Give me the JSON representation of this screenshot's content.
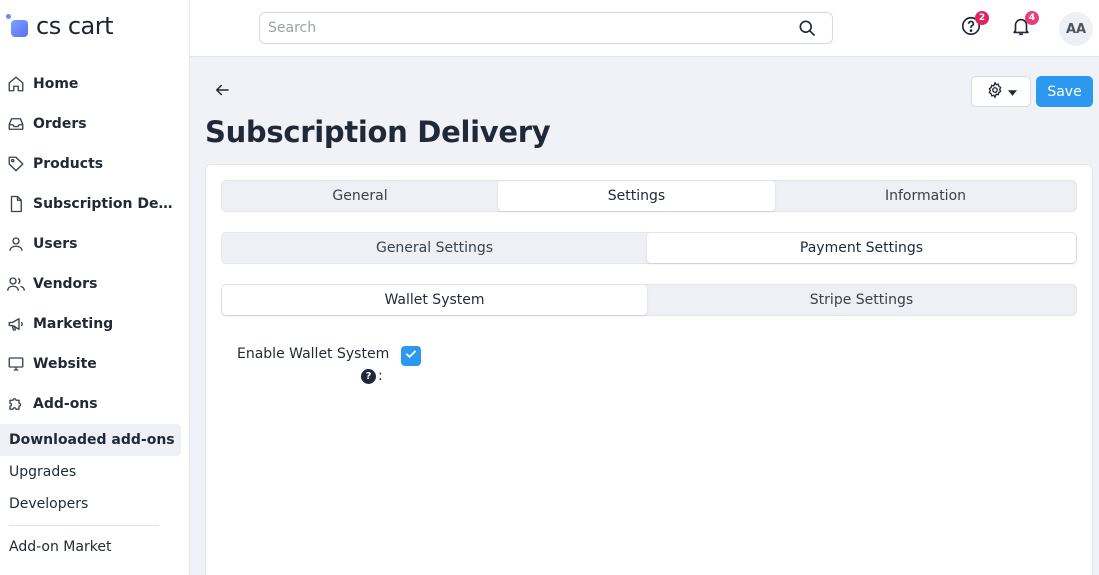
{
  "app": {
    "logo_text": "cs cart"
  },
  "sidebar": {
    "items": [
      {
        "label": "Home",
        "icon": "home-icon"
      },
      {
        "label": "Orders",
        "icon": "inbox-icon"
      },
      {
        "label": "Products",
        "icon": "tag-icon"
      },
      {
        "label": "Subscription Delivery",
        "icon": "file-icon"
      },
      {
        "label": "Users",
        "icon": "user-icon"
      },
      {
        "label": "Vendors",
        "icon": "users-icon"
      },
      {
        "label": "Marketing",
        "icon": "megaphone-icon"
      },
      {
        "label": "Website",
        "icon": "monitor-icon"
      },
      {
        "label": "Add-ons",
        "icon": "puzzle-icon"
      }
    ],
    "subitems": [
      {
        "label": "Downloaded add-ons",
        "active": true
      },
      {
        "label": "Upgrades",
        "active": false
      },
      {
        "label": "Developers",
        "active": false
      },
      {
        "label": "Add-on Market",
        "active": false
      }
    ]
  },
  "topbar": {
    "search_placeholder": "Search",
    "help_badge": "2",
    "notifications_badge": "4",
    "avatar_initials": "AA",
    "badge_help_color": "#e0245e",
    "badge_notif_color": "#e6407a"
  },
  "page": {
    "title": "Subscription Delivery",
    "save_label": "Save",
    "accent_color": "#2c98f0"
  },
  "tabs": {
    "main": [
      {
        "label": "General",
        "active": false
      },
      {
        "label": "Settings",
        "active": true
      },
      {
        "label": "Information",
        "active": false
      }
    ],
    "settings": [
      {
        "label": "General Settings",
        "active": false
      },
      {
        "label": "Payment Settings",
        "active": true
      }
    ],
    "payment": [
      {
        "label": "Wallet System",
        "active": true
      },
      {
        "label": "Stripe Settings",
        "active": false
      }
    ]
  },
  "form": {
    "enable_wallet_label": "Enable Wallet System",
    "help_glyph": "?",
    "colon": ":",
    "enable_wallet_checked": true
  }
}
